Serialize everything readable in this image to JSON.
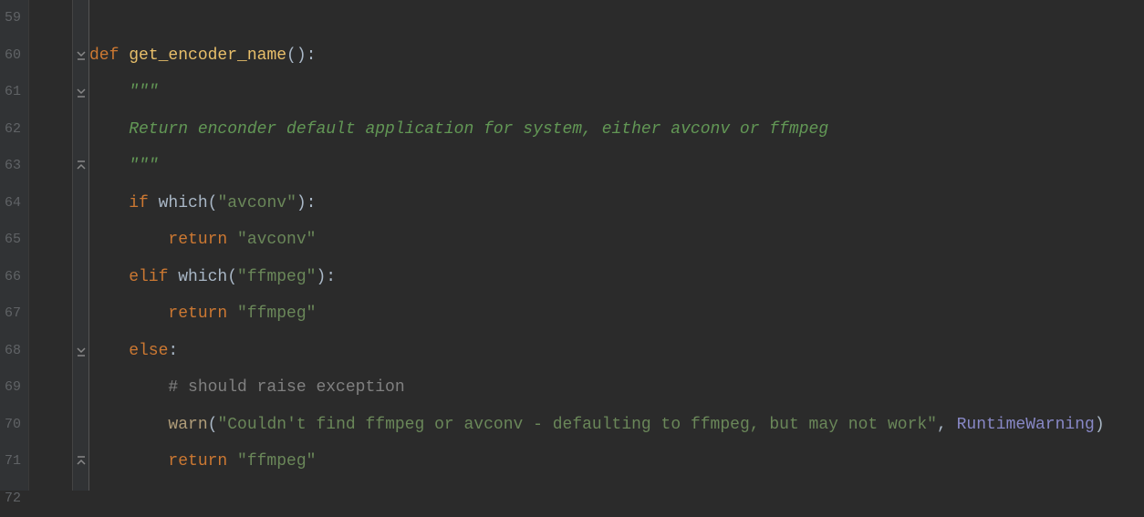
{
  "lines": {
    "n59": "59",
    "n60": "60",
    "n61": "61",
    "n62": "62",
    "n63": "63",
    "n64": "64",
    "n65": "65",
    "n66": "66",
    "n67": "67",
    "n68": "68",
    "n69": "69",
    "n70": "70",
    "n71": "71",
    "n72": "72"
  },
  "code": {
    "l60_def": "def ",
    "l60_fn": "get_encoder_name",
    "l60_paren": "():",
    "l61_doc": "    \"\"\"",
    "l62_doc": "    Return enconder default application for system, either avconv or ffmpeg",
    "l63_doc": "    \"\"\"",
    "l64_if": "    if ",
    "l64_which": "which",
    "l64_op": "(",
    "l64_str": "\"avconv\"",
    "l64_cp": "):",
    "l65_ret": "        return ",
    "l65_str": "\"avconv\"",
    "l66_elif": "    elif ",
    "l66_which": "which",
    "l66_op": "(",
    "l66_str": "\"ffmpeg\"",
    "l66_cp": "):",
    "l67_ret": "        return ",
    "l67_str": "\"ffmpeg\"",
    "l68_else": "    else",
    "l68_colon": ":",
    "l69_comment": "        # should raise exception",
    "l70_indent": "        ",
    "l70_warn": "warn",
    "l70_op": "(",
    "l70_str": "\"Couldn't find ffmpeg or avconv - defaulting to ffmpeg, but may not work\"",
    "l70_comma": ", ",
    "l70_rtw": "RuntimeWarning",
    "l70_cp": ")",
    "l71_ret": "        return ",
    "l71_str": "\"ffmpeg\""
  }
}
